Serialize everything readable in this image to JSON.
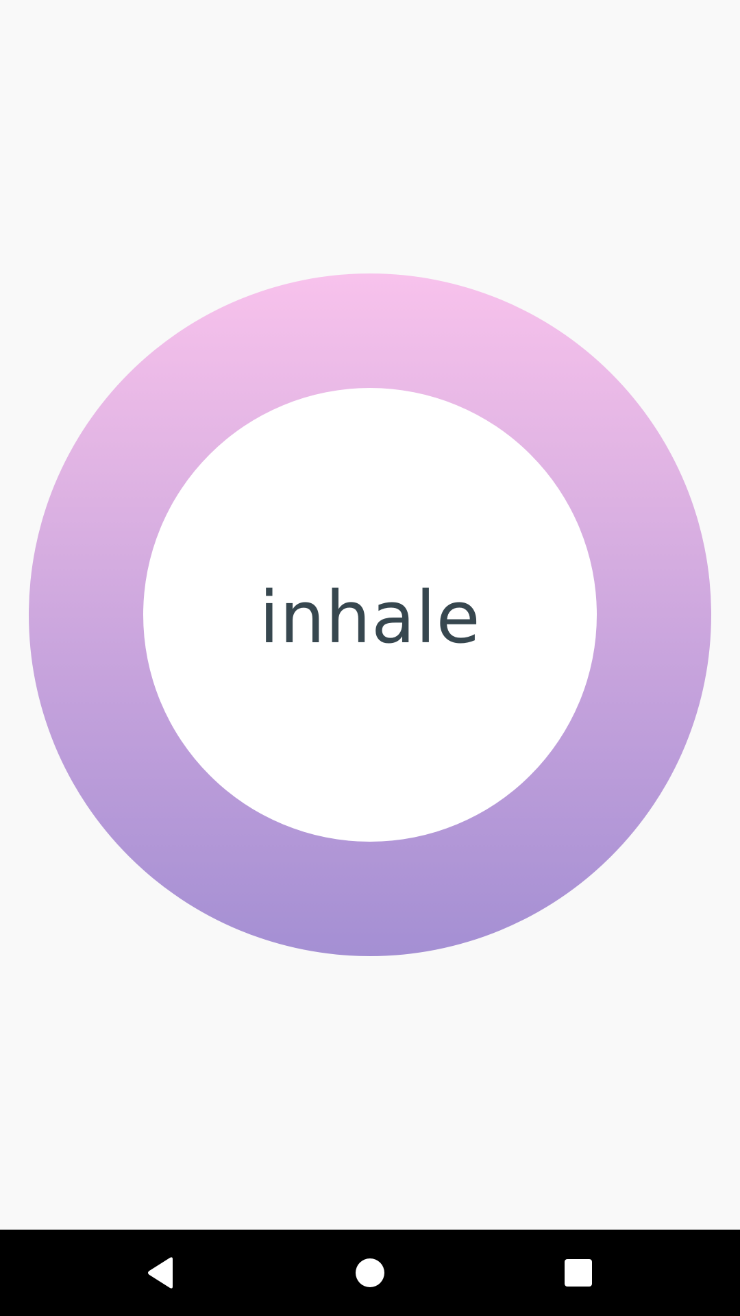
{
  "breathing": {
    "phase_label": "inhale",
    "ring_gradient_top": "#f8c2ec",
    "ring_gradient_bottom": "#a48fd3",
    "core_color": "#ffffff",
    "label_color": "#37474f"
  },
  "system_nav": {
    "back_icon": "back-triangle-icon",
    "home_icon": "home-circle-icon",
    "recents_icon": "recents-square-icon",
    "bar_color": "#000000",
    "icon_color": "#ffffff"
  }
}
